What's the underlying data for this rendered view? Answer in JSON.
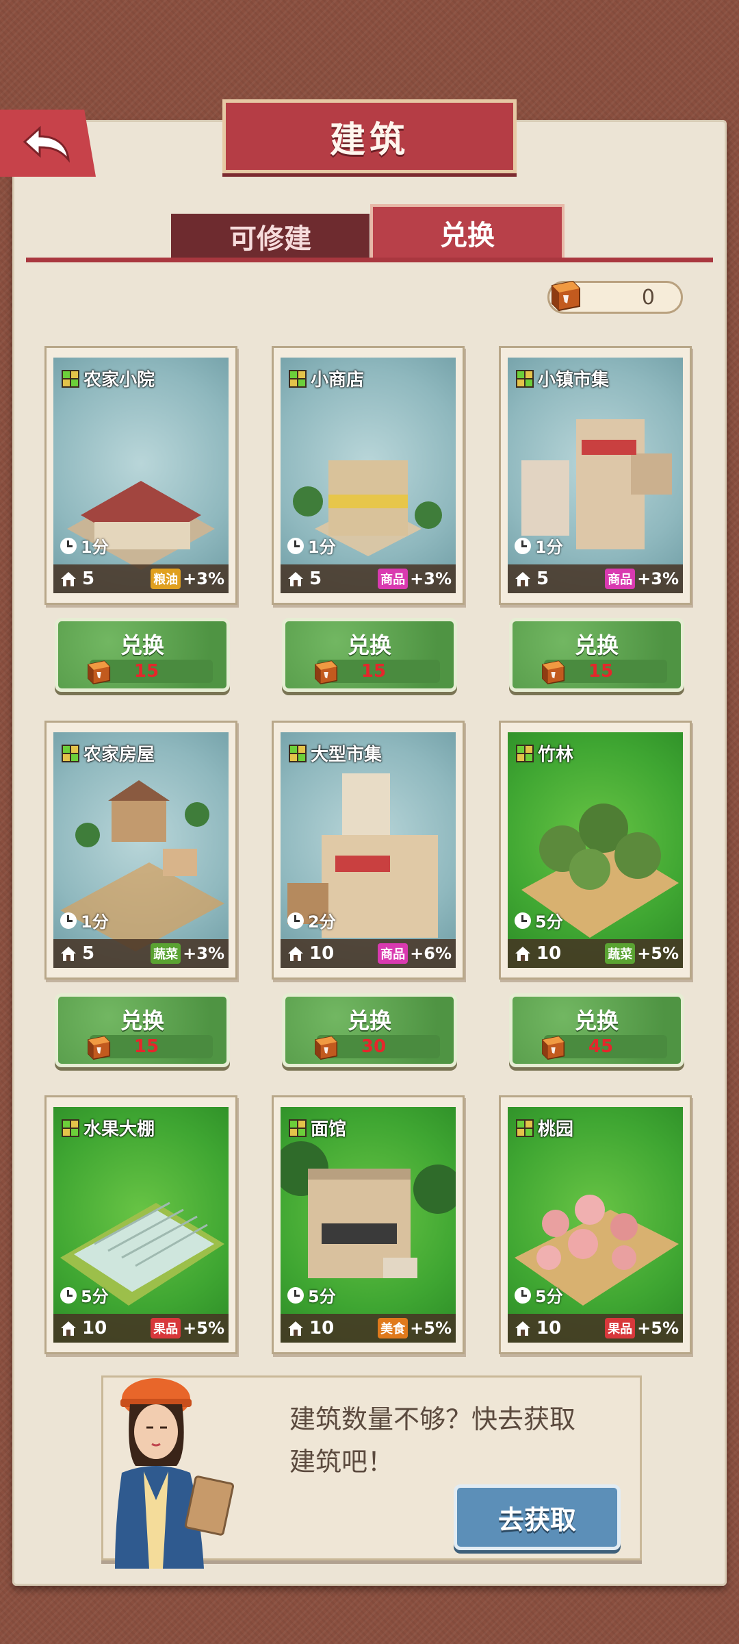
{
  "header": {
    "title": "建筑"
  },
  "tabs": [
    {
      "label": "可修建",
      "active": false
    },
    {
      "label": "兑换",
      "active": true
    }
  ],
  "currency": {
    "value": "0",
    "icon": "brick-icon"
  },
  "buildings": [
    {
      "name": "农家小院",
      "time": "1分",
      "capacity": "5",
      "resource": "粮油",
      "resource_color": "#e0a020",
      "bonus": "+3%",
      "bg": "blue",
      "exchange_label": "兑换",
      "cost": "15"
    },
    {
      "name": "小商店",
      "time": "1分",
      "capacity": "5",
      "resource": "商品",
      "resource_color": "#d93ab0",
      "bonus": "+3%",
      "bg": "blue",
      "exchange_label": "兑换",
      "cost": "15"
    },
    {
      "name": "小镇市集",
      "time": "1分",
      "capacity": "5",
      "resource": "商品",
      "resource_color": "#d93ab0",
      "bonus": "+3%",
      "bg": "blue",
      "exchange_label": "兑换",
      "cost": "15"
    },
    {
      "name": "农家房屋",
      "time": "1分",
      "capacity": "5",
      "resource": "蔬菜",
      "resource_color": "#5aa332",
      "bonus": "+3%",
      "bg": "blue",
      "exchange_label": "兑换",
      "cost": "15"
    },
    {
      "name": "大型市集",
      "time": "2分",
      "capacity": "10",
      "resource": "商品",
      "resource_color": "#d93ab0",
      "bonus": "+6%",
      "bg": "blue",
      "exchange_label": "兑换",
      "cost": "30"
    },
    {
      "name": "竹林",
      "time": "5分",
      "capacity": "10",
      "resource": "蔬菜",
      "resource_color": "#5aa332",
      "bonus": "+5%",
      "bg": "green",
      "exchange_label": "兑换",
      "cost": "45"
    },
    {
      "name": "水果大棚",
      "time": "5分",
      "capacity": "10",
      "resource": "果品",
      "resource_color": "#d8383b",
      "bonus": "+5%",
      "bg": "green"
    },
    {
      "name": "面馆",
      "time": "5分",
      "capacity": "10",
      "resource": "美食",
      "resource_color": "#e07a1c",
      "bonus": "+5%",
      "bg": "green"
    },
    {
      "name": "桃园",
      "time": "5分",
      "capacity": "10",
      "resource": "果品",
      "resource_color": "#d8383b",
      "bonus": "+5%",
      "bg": "green"
    }
  ],
  "prompt": {
    "text": "建筑数量不够？快去获取建筑吧！",
    "button_label": "去获取"
  },
  "colors": {
    "accent_red": "#b53d45",
    "panel": "#ece4d5",
    "exchange_green": "#5fa650",
    "cost_red": "#e5262b"
  }
}
